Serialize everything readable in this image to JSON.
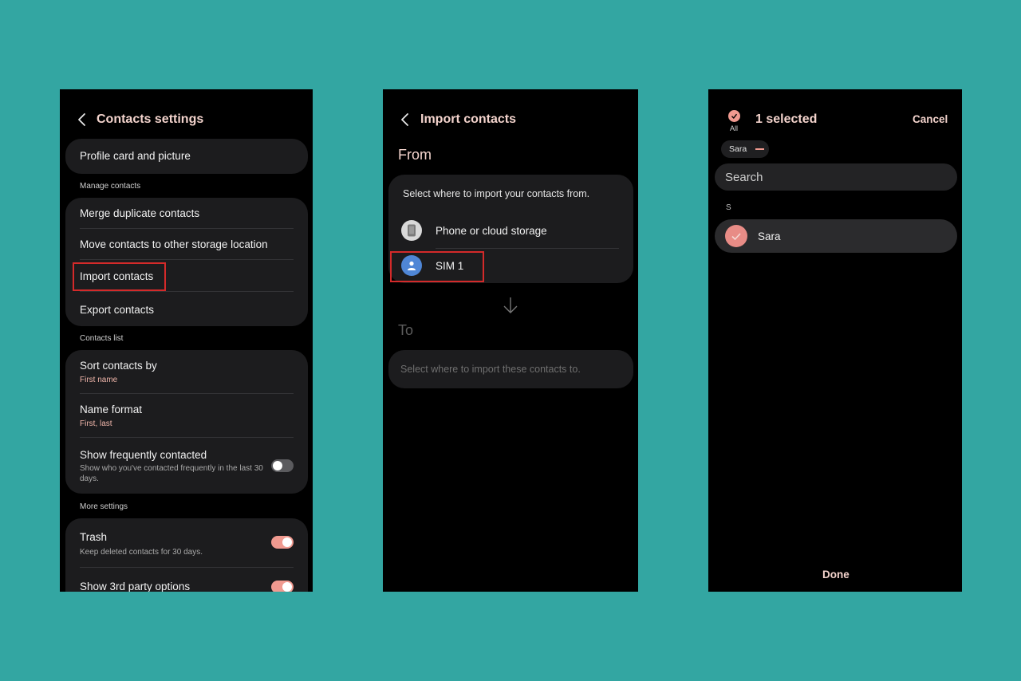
{
  "screen1": {
    "title": "Contacts settings",
    "profile_card": "Profile card and picture",
    "manage_label": "Manage contacts",
    "merge": "Merge duplicate contacts",
    "move": "Move contacts to other storage location",
    "import": "Import contacts",
    "export": "Export contacts",
    "list_label": "Contacts list",
    "sort_title": "Sort contacts by",
    "sort_value": "First name",
    "name_format_title": "Name format",
    "name_format_value": "First, last",
    "freq_title": "Show frequently contacted",
    "freq_desc": "Show who you've contacted frequently in the last 30 days.",
    "freq_enabled": false,
    "more_label": "More settings",
    "trash_title": "Trash",
    "trash_desc": "Keep deleted contacts for 30 days.",
    "trash_enabled": true,
    "third_party_title": "Show 3rd party options",
    "third_party_enabled": true
  },
  "screen2": {
    "title": "Import contacts",
    "from_label": "From",
    "from_prompt": "Select where to import your contacts from.",
    "source_phone": "Phone or cloud storage",
    "source_sim": "SIM 1",
    "to_label": "To",
    "to_prompt": "Select where to import these contacts to."
  },
  "screen3": {
    "all_label": "All",
    "selected_count": "1 selected",
    "cancel": "Cancel",
    "chip_name": "Sara",
    "search_placeholder": "Search",
    "index_letter": "S",
    "contact_name": "Sara",
    "done": "Done"
  },
  "colors": {
    "background": "#33a6a2",
    "accent": "#f3d3cc",
    "toggle_on": "#f09a90",
    "highlight_box": "#d42a2a"
  }
}
